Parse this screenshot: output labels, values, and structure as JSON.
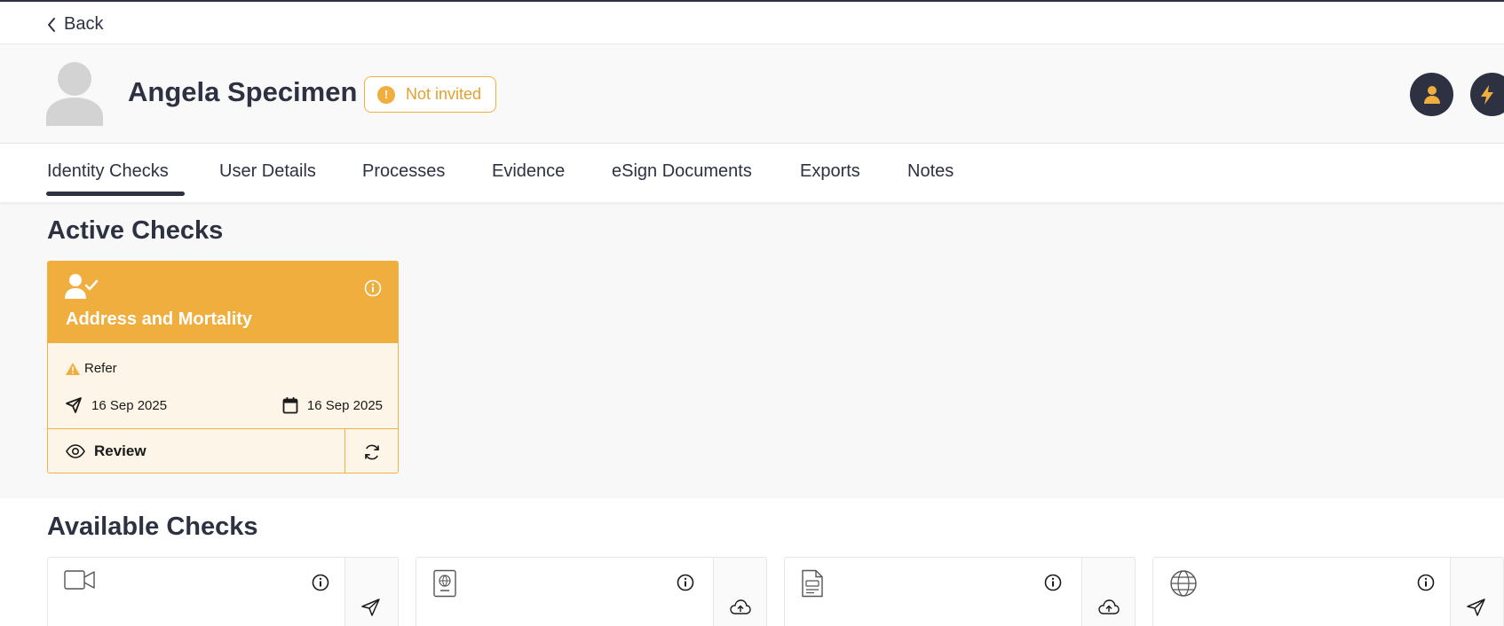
{
  "nav": {
    "back_label": "Back"
  },
  "profile": {
    "name": "Angela Specimen",
    "status_label": "Not invited",
    "status_color": "#efae3e"
  },
  "tabs": [
    {
      "label": "Identity Checks",
      "active": true
    },
    {
      "label": "User Details"
    },
    {
      "label": "Processes"
    },
    {
      "label": "Evidence"
    },
    {
      "label": "eSign Documents"
    },
    {
      "label": "Exports"
    },
    {
      "label": "Notes"
    }
  ],
  "active_checks": {
    "title": "Active Checks",
    "cards": [
      {
        "title": "Address and Mortality",
        "icon": "user-check-icon",
        "result": "Refer",
        "sent_date": "16 Sep 2025",
        "due_date": "16 Sep 2025",
        "review_label": "Review"
      }
    ]
  },
  "available_checks": {
    "title": "Available Checks",
    "cards": [
      {
        "icon": "video-icon",
        "action_icon": "send-icon"
      },
      {
        "icon": "passport-icon",
        "action_icon": "upload-cloud-icon"
      },
      {
        "icon": "document-icon",
        "action_icon": "upload-cloud-icon"
      },
      {
        "icon": "globe-icon",
        "action_icon": "send-icon"
      }
    ]
  },
  "colors": {
    "primary_dark": "#2d3142",
    "accent_orange": "#efae3e",
    "card_tint": "#fdf5e8"
  }
}
